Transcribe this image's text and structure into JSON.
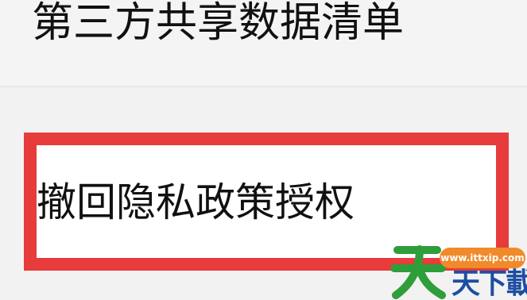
{
  "header": {
    "title": "第三方共享数据清单"
  },
  "menu": {
    "revoke_label": "撤回隐私政策授权"
  },
  "watermark": {
    "url": "www.ittxip.com",
    "brand": "天下載",
    "logo_char": "天"
  },
  "colors": {
    "highlight_border": "#e83b3b",
    "watermark_green": "#2e9e3a",
    "watermark_orange": "#f08a2a",
    "watermark_blue": "#1e4ea1"
  }
}
